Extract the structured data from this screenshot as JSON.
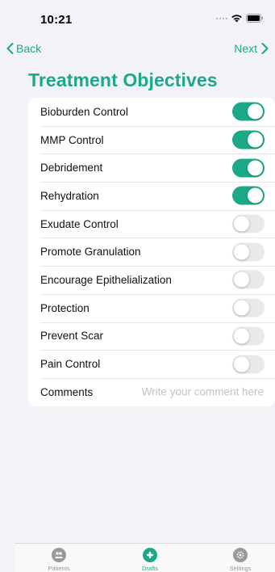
{
  "status": {
    "time": "10:21"
  },
  "nav": {
    "back_label": "Back",
    "next_label": "Next"
  },
  "title": "Treatment Objectives",
  "accent_color": "#1ea88a",
  "objectives": [
    {
      "label": "Bioburden Control",
      "on": true
    },
    {
      "label": "MMP Control",
      "on": true
    },
    {
      "label": "Debridement",
      "on": true
    },
    {
      "label": "Rehydration",
      "on": true
    },
    {
      "label": "Exudate Control",
      "on": false
    },
    {
      "label": "Promote Granulation",
      "on": false
    },
    {
      "label": "Encourage Epithelialization",
      "on": false
    },
    {
      "label": "Protection",
      "on": false
    },
    {
      "label": "Prevent Scar",
      "on": false
    },
    {
      "label": "Pain Control",
      "on": false
    }
  ],
  "comments": {
    "label": "Comments",
    "value": "",
    "placeholder": "Write your comment here"
  },
  "tabs": [
    {
      "label": "Patients",
      "icon": "people-icon",
      "active": false
    },
    {
      "label": "Drafts",
      "icon": "plus-circle-icon",
      "active": true
    },
    {
      "label": "Settings",
      "icon": "gear-icon",
      "active": false
    }
  ]
}
